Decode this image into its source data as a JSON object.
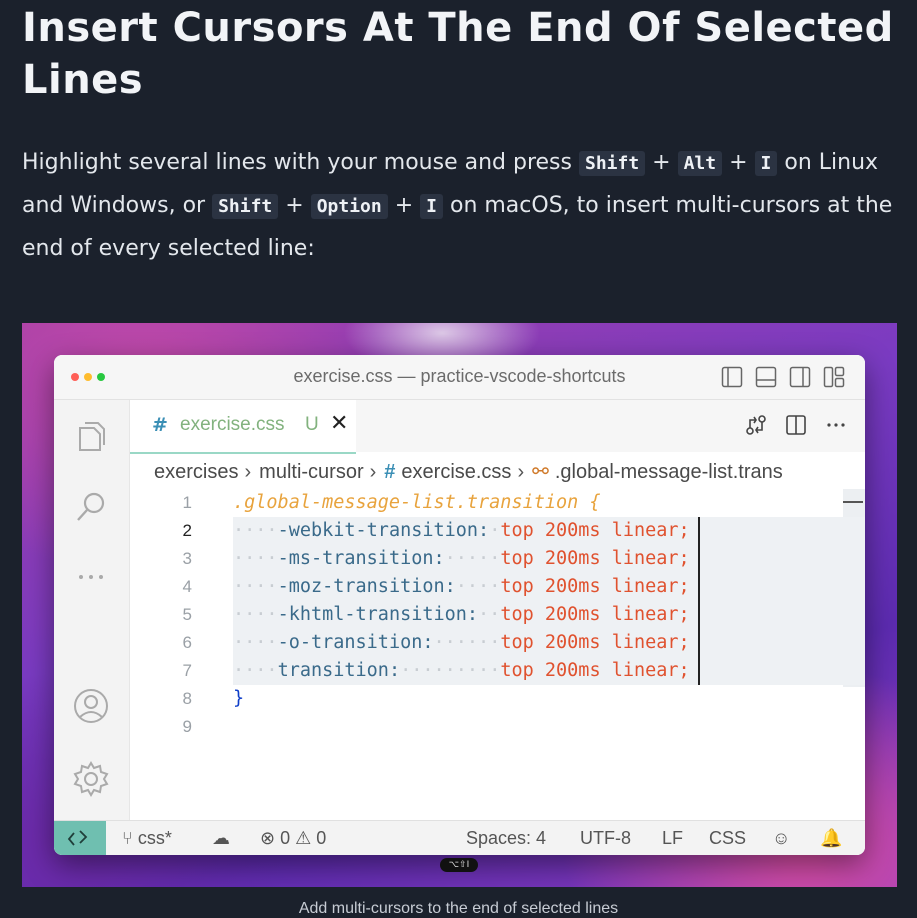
{
  "article": {
    "heading": "Insert Cursors At The End Of Selected Lines",
    "intro_parts": {
      "t1": "Highlight several lines with your mouse and press ",
      "k1": "Shift",
      "p1": " + ",
      "k2": "Alt",
      "p2": " + ",
      "k3": "I",
      "t2": " on Linux and Windows, or ",
      "k4": "Shift",
      "p3": " + ",
      "k5": "Option",
      "p4": " + ",
      "k6": "I",
      "t3": " on macOS, to insert multi-cursors at the end of every selected line:"
    },
    "caption": "Add multi-cursors to the end of selected lines"
  },
  "vscode": {
    "window_title": "exercise.css — practice-vscode-shortcuts",
    "tab": {
      "hash": "#",
      "name": "exercise.css",
      "status": "U",
      "close": "✕"
    },
    "breadcrumb": {
      "folder": "exercises",
      "subfolder": "multi-cursor",
      "hash": "#",
      "file": "exercise.css",
      "symbol": ".global-message-list.trans"
    },
    "lines": [
      {
        "n": "1",
        "text": ".global-message-list.transition {"
      },
      {
        "n": "2",
        "prop": "-webkit-transition:",
        "pad": " ",
        "value": "top 200ms linear;"
      },
      {
        "n": "3",
        "prop": "-ms-transition:",
        "pad": "     ",
        "value": "top 200ms linear;"
      },
      {
        "n": "4",
        "prop": "-moz-transition:",
        "pad": "    ",
        "value": "top 200ms linear;"
      },
      {
        "n": "5",
        "prop": "-khtml-transition:",
        "pad": "  ",
        "value": "top 200ms linear;"
      },
      {
        "n": "6",
        "prop": "-o-transition:",
        "pad": "      ",
        "value": "top 200ms linear;"
      },
      {
        "n": "7",
        "prop": "transition:",
        "pad": "         ",
        "value": "top 200ms linear;"
      },
      {
        "n": "8",
        "text": "}"
      },
      {
        "n": "9",
        "text": ""
      }
    ],
    "status": {
      "branch": "css*",
      "errors": "0",
      "warnings": "0",
      "spaces": "Spaces: 4",
      "encoding": "UTF-8",
      "eol": "LF",
      "language": "CSS"
    },
    "keycast": "⌥⇧I"
  },
  "colors": {
    "page_bg": "#1b212c",
    "accent_tab_border": "#9ad8c6",
    "remote_bg": "#6fbfb0"
  }
}
